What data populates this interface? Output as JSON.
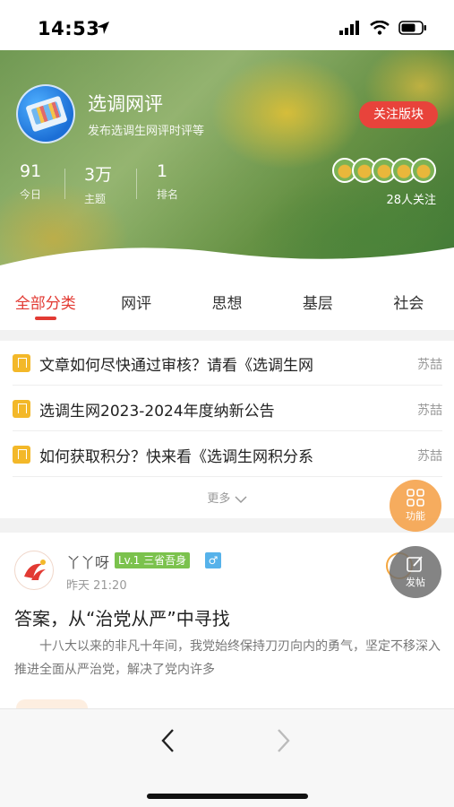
{
  "status": {
    "time": "14:53"
  },
  "board": {
    "title": "选调网评",
    "description": "发布选调生网评时评等",
    "follow_label": "关注版块",
    "followers": "28人关注",
    "stats": [
      {
        "value": "91",
        "label": "今日"
      },
      {
        "value": "3万",
        "label": "主题"
      },
      {
        "value": "1",
        "label": "排名"
      }
    ]
  },
  "tabs": [
    {
      "label": "全部分类",
      "active": true
    },
    {
      "label": "网评",
      "active": false
    },
    {
      "label": "思想",
      "active": false
    },
    {
      "label": "基层",
      "active": false
    },
    {
      "label": "社会",
      "active": false
    }
  ],
  "pinned": [
    {
      "title": "文章如何尽快通过审核？请看《选调生网",
      "author": "苏喆"
    },
    {
      "title": "选调生网2023-2024年度纳新公告",
      "author": "苏喆"
    },
    {
      "title": "如何获取积分？快来看《选调生网积分系",
      "author": "苏喆"
    }
  ],
  "more_label": "更多",
  "fab": {
    "function_label": "功能",
    "post_label": "发帖"
  },
  "post": {
    "author": "丫丫呀",
    "level": "Lv.1 三省吾身",
    "gender": "♂",
    "time": "昨天 21:20",
    "title": "答案，从“治党从严”中寻找",
    "excerpt": "十八大以来的非凡十年间，我党始终保持刀刃向内的勇气，坚定不移深入推进全面从严治党，解决了党内许多"
  },
  "icons": {
    "location": "location-arrow-icon",
    "signal": "signal-icon",
    "wifi": "wifi-icon",
    "battery": "battery-icon",
    "back": "chevron-left-icon",
    "forward": "chevron-right-icon"
  },
  "colors": {
    "accent": "#e23a33",
    "pin": "#f3b829",
    "level": "#7bc24d",
    "gender": "#56b2ea"
  }
}
